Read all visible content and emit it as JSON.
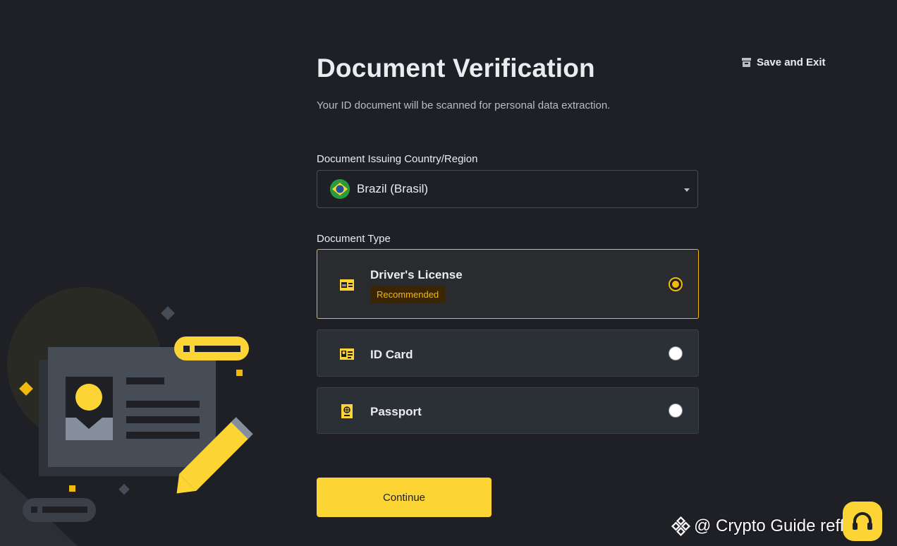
{
  "header": {
    "save_exit_label": "Save and Exit",
    "save_exit_icon": "archive-icon"
  },
  "page": {
    "title": "Document Verification",
    "subtitle": "Your ID document will be scanned for personal data extraction."
  },
  "country": {
    "label": "Document Issuing Country/Region",
    "selected": "Brazil (Brasil)",
    "flag_icon": "brazil-flag-icon"
  },
  "document_type": {
    "label": "Document Type",
    "options": [
      {
        "label": "Driver's License",
        "badge": "Recommended",
        "icon": "drivers-license-icon",
        "selected": true
      },
      {
        "label": "ID Card",
        "icon": "id-card-icon",
        "selected": false
      },
      {
        "label": "Passport",
        "icon": "passport-icon",
        "selected": false
      }
    ]
  },
  "actions": {
    "continue_label": "Continue"
  },
  "watermark": {
    "text": "@ Crypto Guide reffera..."
  },
  "colors": {
    "background": "#1e2026",
    "accent": "#fcd535",
    "selected_border": "#f0b90b",
    "card": "#2b2f36"
  }
}
